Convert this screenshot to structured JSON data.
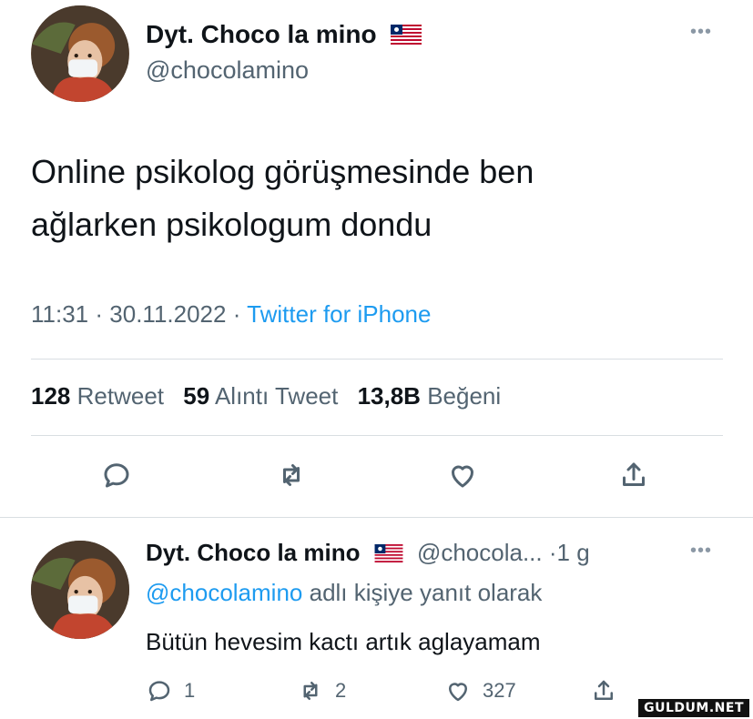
{
  "tweet": {
    "author": {
      "display_name": "Dyt. Choco la mino",
      "handle": "@chocolamino",
      "flag_icon": "liberia-flag-icon"
    },
    "more_icon": "more-horizontal-icon",
    "text_line1": "Online psikolog görüşmesinde ben",
    "text_line2": "ağlarken psikologum dondu",
    "time": "11:31",
    "separator": "·",
    "date": "30.11.2022",
    "source": "Twitter for iPhone",
    "stats": {
      "retweets_count": "128",
      "retweets_label": "Retweet",
      "quotes_count": "59",
      "quotes_label": "Alıntı Tweet",
      "likes_count": "13,8B",
      "likes_label": "Beğeni"
    },
    "actions": [
      "reply-icon",
      "retweet-icon",
      "like-icon",
      "share-icon"
    ]
  },
  "reply": {
    "author": {
      "display_name": "Dyt. Choco la mino",
      "handle_truncated": "@chocola...",
      "time_ago": "1 g"
    },
    "replying_to_mention": "@chocolamino",
    "replying_to_suffix": "adlı kişiye yanıt olarak",
    "text": "Bütün hevesim kactı artık aglayamam",
    "counts": {
      "replies": "1",
      "retweets": "2",
      "likes": "327"
    }
  },
  "watermark": "GULDUM.NET",
  "colors": {
    "link": "#1d9bf0",
    "secondary": "#536471",
    "primary_text": "#0f1419"
  }
}
